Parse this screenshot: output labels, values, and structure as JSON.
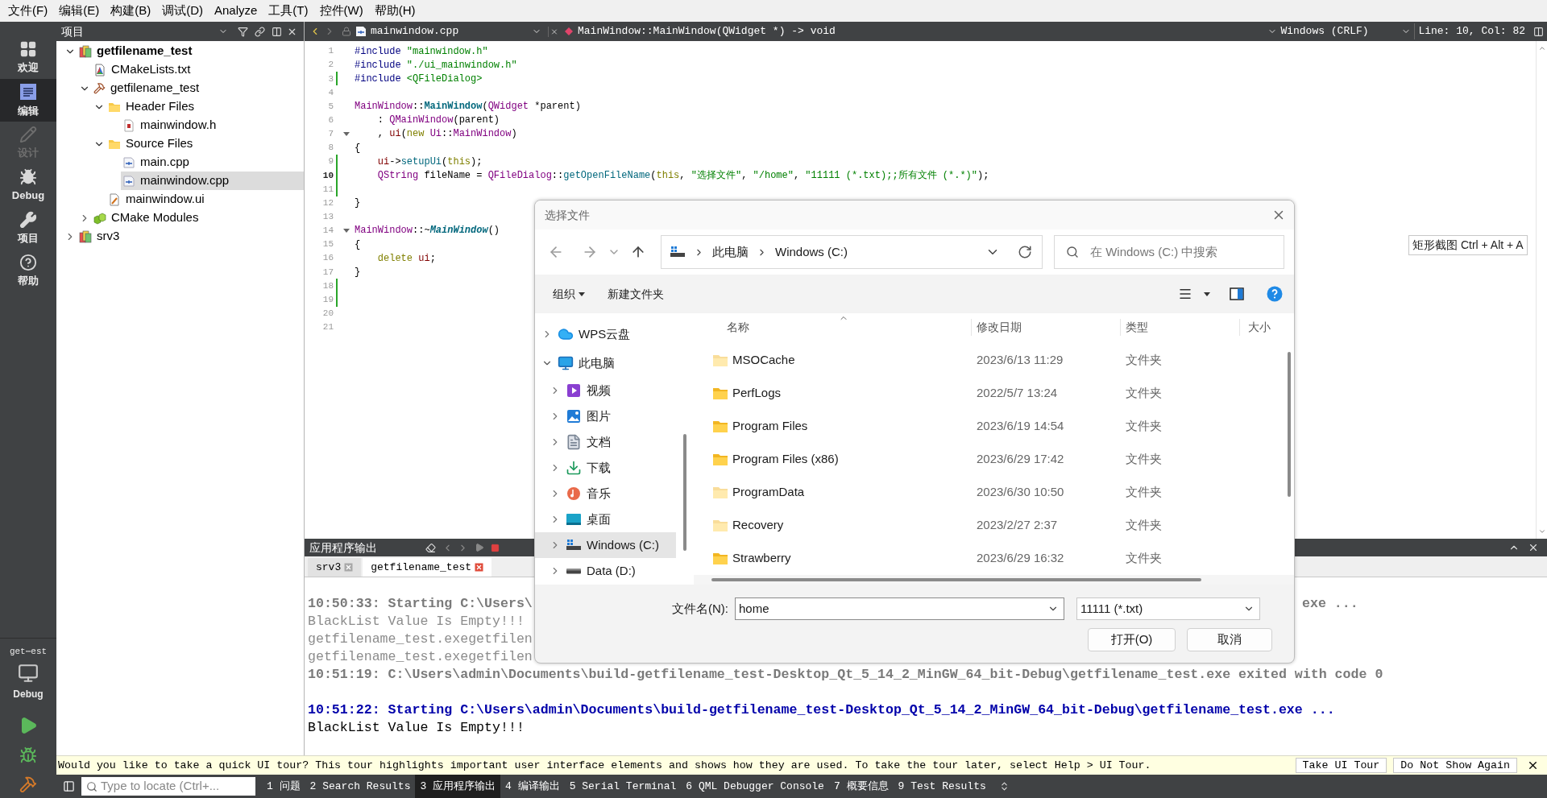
{
  "menu_bar": [
    "文件(F)",
    "编辑(E)",
    "构建(B)",
    "调试(D)",
    "Analyze",
    "工具(T)",
    "控件(W)",
    "帮助(H)"
  ],
  "mode_bar": {
    "modes": [
      {
        "label": "欢迎",
        "kind": "welcome",
        "selected": false,
        "disabled": false
      },
      {
        "label": "编辑",
        "kind": "edit",
        "selected": true,
        "disabled": false
      },
      {
        "label": "设计",
        "kind": "design",
        "selected": false,
        "disabled": true
      },
      {
        "label": "Debug",
        "kind": "debug",
        "selected": false,
        "disabled": false
      },
      {
        "label": "项目",
        "kind": "projects",
        "selected": false,
        "disabled": false
      },
      {
        "label": "帮助",
        "kind": "help",
        "selected": false,
        "disabled": false
      }
    ],
    "kit": {
      "project": "get⋯est",
      "configuration": "Debug"
    }
  },
  "project_panel": {
    "title": "项目",
    "tree": [
      {
        "label": "getfilename_test",
        "kind": "project",
        "expanded": true,
        "selected": false,
        "children": [
          {
            "label": "CMakeLists.txt",
            "kind": "cmake",
            "selected": false
          },
          {
            "label": "getfilename_test",
            "kind": "target",
            "expanded": true,
            "selected": false,
            "children": [
              {
                "label": "Header Files",
                "kind": "folder",
                "expanded": true,
                "selected": false,
                "children": [
                  {
                    "label": "mainwindow.h",
                    "kind": "header",
                    "selected": false
                  }
                ]
              },
              {
                "label": "Source Files",
                "kind": "folder",
                "expanded": true,
                "selected": false,
                "children": [
                  {
                    "label": "main.cpp",
                    "kind": "source",
                    "selected": false
                  },
                  {
                    "label": "mainwindow.cpp",
                    "kind": "source",
                    "selected": true
                  }
                ]
              },
              {
                "label": "mainwindow.ui",
                "kind": "ui",
                "selected": false
              }
            ]
          },
          {
            "label": "CMake Modules",
            "kind": "modules",
            "expanded": false,
            "selected": false
          }
        ]
      },
      {
        "label": "srv3",
        "kind": "project",
        "expanded": false,
        "selected": false
      }
    ]
  },
  "editor": {
    "file": "mainwindow.cpp",
    "symbol": "MainWindow::MainWindow(QWidget *) -> void",
    "line_ending": "Windows (CRLF)",
    "position": "Line: 10, Col: 82",
    "lines": [
      {
        "number": "1",
        "modified": false,
        "current": false,
        "foldable": false,
        "tokens": [
          {
            "kind": "preproc",
            "text": "#include "
          },
          {
            "kind": "string",
            "text": "\"mainwindow.h\""
          }
        ]
      },
      {
        "number": "2",
        "modified": false,
        "current": false,
        "foldable": false,
        "tokens": [
          {
            "kind": "preproc",
            "text": "#include "
          },
          {
            "kind": "string",
            "text": "\"./ui_mainwindow.h\""
          }
        ]
      },
      {
        "number": "3",
        "modified": true,
        "current": false,
        "foldable": false,
        "tokens": [
          {
            "kind": "preproc",
            "text": "#include "
          },
          {
            "kind": "string",
            "text": "<QFileDialog>"
          }
        ]
      },
      {
        "number": "4",
        "modified": false,
        "current": false,
        "foldable": false
      },
      {
        "number": "5",
        "modified": false,
        "current": false,
        "foldable": false,
        "tokens": [
          {
            "kind": "type",
            "text": "MainWindow"
          },
          {
            "kind": "plain",
            "text": "::"
          },
          {
            "kind": "declaration",
            "text": "MainWindow"
          },
          {
            "kind": "plain",
            "text": "("
          },
          {
            "kind": "type",
            "text": "QWidget"
          },
          {
            "kind": "plain",
            "text": " *parent)"
          }
        ]
      },
      {
        "number": "6",
        "modified": false,
        "current": false,
        "foldable": false,
        "tokens": [
          {
            "kind": "plain",
            "text": "    : "
          },
          {
            "kind": "type",
            "text": "QMainWindow"
          },
          {
            "kind": "plain",
            "text": "(parent)"
          }
        ]
      },
      {
        "number": "7",
        "modified": false,
        "current": false,
        "foldable": true,
        "tokens": [
          {
            "kind": "plain",
            "text": "    , "
          },
          {
            "kind": "field",
            "text": "ui"
          },
          {
            "kind": "plain",
            "text": "("
          },
          {
            "kind": "keyword",
            "text": "new "
          },
          {
            "kind": "type",
            "text": "Ui"
          },
          {
            "kind": "plain",
            "text": "::"
          },
          {
            "kind": "type",
            "text": "MainWindow"
          },
          {
            "kind": "plain",
            "text": ")"
          }
        ]
      },
      {
        "number": "8",
        "modified": false,
        "current": false,
        "foldable": false,
        "tokens": [
          {
            "kind": "plain",
            "text": "{"
          }
        ]
      },
      {
        "number": "9",
        "modified": true,
        "current": false,
        "foldable": false,
        "tokens": [
          {
            "kind": "field",
            "text": "    ui"
          },
          {
            "kind": "plain",
            "text": "->"
          },
          {
            "kind": "function",
            "text": "setupUi"
          },
          {
            "kind": "plain",
            "text": "("
          },
          {
            "kind": "keyword",
            "text": "this"
          },
          {
            "kind": "plain",
            "text": ");"
          }
        ]
      },
      {
        "number": "10",
        "modified": true,
        "current": true,
        "foldable": false,
        "tokens": [
          {
            "kind": "type",
            "text": "    QString"
          },
          {
            "kind": "plain",
            "text": " fileName = "
          },
          {
            "kind": "type",
            "text": "QFileDialog"
          },
          {
            "kind": "plain",
            "text": "::"
          },
          {
            "kind": "function",
            "text": "getOpenFileName"
          },
          {
            "kind": "plain",
            "text": "("
          },
          {
            "kind": "keyword",
            "text": "this"
          },
          {
            "kind": "plain",
            "text": ", "
          },
          {
            "kind": "string",
            "text": "\"选择文件\""
          },
          {
            "kind": "plain",
            "text": ", "
          },
          {
            "kind": "string",
            "text": "\"/home\""
          },
          {
            "kind": "plain",
            "text": ", "
          },
          {
            "kind": "string",
            "text": "\"11111 (*.txt);;所有文件 (*.*)\""
          },
          {
            "kind": "plain",
            "text": ");"
          }
        ]
      },
      {
        "number": "11",
        "modified": true,
        "current": false,
        "foldable": false
      },
      {
        "number": "12",
        "modified": false,
        "current": false,
        "foldable": false,
        "tokens": [
          {
            "kind": "plain",
            "text": "}"
          }
        ]
      },
      {
        "number": "13",
        "modified": false,
        "current": false,
        "foldable": false
      },
      {
        "number": "14",
        "modified": false,
        "current": false,
        "foldable": true,
        "tokens": [
          {
            "kind": "type",
            "text": "MainWindow"
          },
          {
            "kind": "plain",
            "text": "::~"
          },
          {
            "kind": "virtual",
            "text": "MainWindow"
          },
          {
            "kind": "plain",
            "text": "()"
          }
        ]
      },
      {
        "number": "15",
        "modified": false,
        "current": false,
        "foldable": false,
        "tokens": [
          {
            "kind": "plain",
            "text": "{"
          }
        ]
      },
      {
        "number": "16",
        "modified": false,
        "current": false,
        "foldable": false,
        "tokens": [
          {
            "kind": "keyword",
            "text": "    delete "
          },
          {
            "kind": "field",
            "text": "ui"
          },
          {
            "kind": "plain",
            "text": ";"
          }
        ]
      },
      {
        "number": "17",
        "modified": false,
        "current": false,
        "foldable": false,
        "tokens": [
          {
            "kind": "plain",
            "text": "}"
          }
        ]
      },
      {
        "number": "18",
        "modified": true,
        "current": false,
        "foldable": false
      },
      {
        "number": "19",
        "modified": true,
        "current": false,
        "foldable": false
      },
      {
        "number": "20",
        "modified": false,
        "current": false,
        "foldable": false
      },
      {
        "number": "21",
        "modified": false,
        "current": false,
        "foldable": false
      }
    ]
  },
  "output": {
    "title": "应用程序输出",
    "tabs": [
      {
        "label": "srv3",
        "selected": false
      },
      {
        "label": "getfilename_test",
        "selected": true
      }
    ],
    "lines": [
      {
        "kind": "status_old",
        "text": "10:50:33: Starting C:\\Users\\",
        "tail": "exe ..."
      },
      {
        "kind": "output_old",
        "text": "BlackList Value Is Empty!!!"
      },
      {
        "kind": "output_old",
        "text": "getfilename_test.exegetfilen"
      },
      {
        "kind": "output_old",
        "text": "getfilename_test.exegetfilen"
      },
      {
        "kind": "status_old",
        "text": "10:51:19: C:\\Users\\admin\\Documents\\build-getfilename_test-Desktop_Qt_5_14_2_MinGW_64_bit-Debug\\getfilename_test.exe exited with code 0"
      },
      {
        "kind": "blank"
      },
      {
        "kind": "status",
        "text": "10:51:22: Starting C:\\Users\\admin\\Documents\\build-getfilename_test-Desktop_Qt_5_14_2_MinGW_64_bit-Debug\\getfilename_test.exe ..."
      },
      {
        "kind": "output",
        "text": "BlackList Value Is Empty!!!"
      }
    ]
  },
  "dialog": {
    "title": "选择文件",
    "path": [
      "此电脑",
      "Windows (C:)"
    ],
    "search_placeholder": "在 Windows (C:) 中搜索",
    "organize": "组织",
    "new_folder": "新建文件夹",
    "nav_tree": [
      {
        "label": "WPS云盘",
        "kind": "cloud",
        "expanded": false,
        "selected": false
      },
      {
        "label": "此电脑",
        "kind": "pc",
        "expanded": true,
        "selected": false,
        "children": [
          {
            "label": "视频",
            "kind": "videos",
            "expanded": false,
            "selected": false
          },
          {
            "label": "图片",
            "kind": "pictures",
            "expanded": false,
            "selected": false
          },
          {
            "label": "文档",
            "kind": "documents",
            "expanded": false,
            "selected": false
          },
          {
            "label": "下载",
            "kind": "downloads",
            "expanded": false,
            "selected": false
          },
          {
            "label": "音乐",
            "kind": "music",
            "expanded": false,
            "selected": false
          },
          {
            "label": "桌面",
            "kind": "desktop",
            "expanded": false,
            "selected": false
          },
          {
            "label": "Windows (C:)",
            "kind": "system_drive",
            "expanded": false,
            "selected": true
          },
          {
            "label": "Data (D:)",
            "kind": "drive",
            "expanded": false,
            "selected": false
          }
        ]
      }
    ],
    "columns": [
      "名称",
      "修改日期",
      "类型",
      "大小"
    ],
    "files": [
      {
        "name": "MSOCache",
        "modified": "2023/6/13 11:29",
        "type": "文件夹",
        "hidden": true
      },
      {
        "name": "PerfLogs",
        "modified": "2022/5/7 13:24",
        "type": "文件夹",
        "hidden": false
      },
      {
        "name": "Program Files",
        "modified": "2023/6/19 14:54",
        "type": "文件夹",
        "hidden": false
      },
      {
        "name": "Program Files (x86)",
        "modified": "2023/6/29 17:42",
        "type": "文件夹",
        "hidden": false
      },
      {
        "name": "ProgramData",
        "modified": "2023/6/30 10:50",
        "type": "文件夹",
        "hidden": true
      },
      {
        "name": "Recovery",
        "modified": "2023/2/27 2:37",
        "type": "文件夹",
        "hidden": true
      },
      {
        "name": "Strawberry",
        "modified": "2023/6/29 16:32",
        "type": "文件夹",
        "hidden": false
      }
    ],
    "file_name": {
      "label": "文件名(N):",
      "value": "home"
    },
    "filter": "11111 (*.txt)",
    "buttons": [
      "打开(O)",
      "取消"
    ]
  },
  "tooltip": "矩形截图 Ctrl + Alt + A",
  "tour_bar": {
    "message": "Would you like to take a quick UI tour? This tour highlights important user interface elements and shows how they are used. To take the tour later, select Help > UI Tour.",
    "buttons": [
      "Take UI Tour",
      "Do Not Show Again"
    ]
  },
  "status_bar": {
    "locator_placeholder": "Type to locate (Ctrl+...",
    "panes": [
      {
        "label": "1 问题",
        "selected": false
      },
      {
        "label": "2 Search Results",
        "selected": false
      },
      {
        "label": "3 应用程序输出",
        "selected": true
      },
      {
        "label": "4 编译输出",
        "selected": false
      },
      {
        "label": "5 Serial Terminal",
        "selected": false
      },
      {
        "label": "6 QML Debugger Console",
        "selected": false
      },
      {
        "label": "7 概要信息",
        "selected": false
      },
      {
        "label": "9 Test Results",
        "selected": false
      }
    ]
  }
}
